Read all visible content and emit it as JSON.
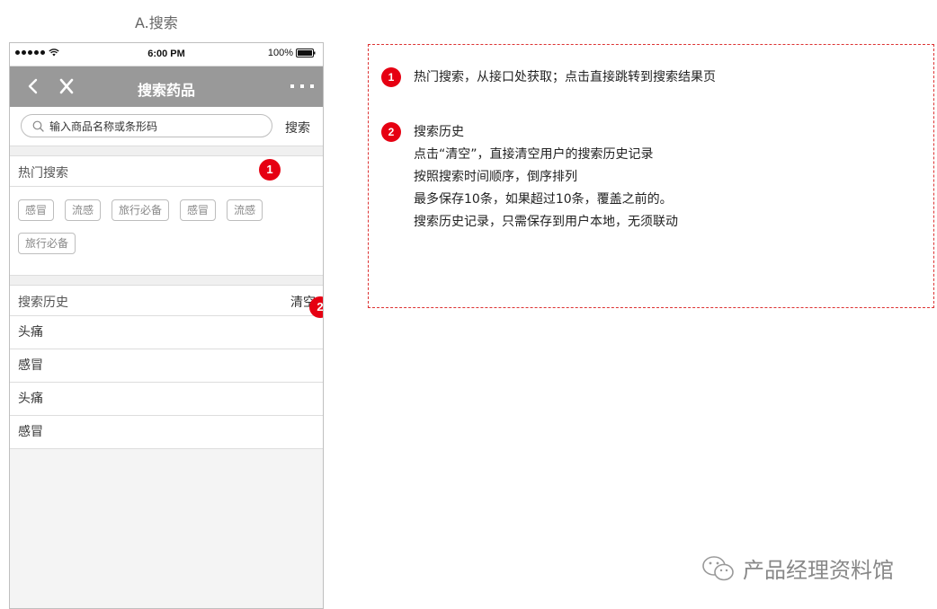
{
  "page": {
    "title": "A.搜索"
  },
  "status_bar": {
    "time": "6:00 PM",
    "battery": "100%"
  },
  "nav": {
    "title": "搜索药品",
    "close_label": "X"
  },
  "search": {
    "placeholder": "输入商品名称或条形码",
    "button_label": "搜索"
  },
  "hot_search": {
    "label": "热门搜索",
    "badge": "1",
    "tags": [
      "感冒",
      "流感",
      "旅行必备",
      "感冒",
      "流感",
      "旅行必备"
    ]
  },
  "history": {
    "label": "搜索历史",
    "clear_label": "清空",
    "badge": "2",
    "items": [
      "头痛",
      "感冒",
      "头痛",
      "感冒"
    ]
  },
  "notes": [
    {
      "badge": "1",
      "lines": [
        "热门搜索，从接口处获取；点击直接跳转到搜索结果页"
      ]
    },
    {
      "badge": "2",
      "lines": [
        "搜索历史",
        "点击“清空”，直接清空用户的搜索历史记录",
        "按照搜索时间顺序，倒序排列",
        "最多保存10条，如果超过10条，覆盖之前的。",
        "搜索历史记录，只需保存到用户本地，无须联动"
      ]
    }
  ],
  "watermark": {
    "text": "产品经理资料馆"
  },
  "colors": {
    "nav": "#999999",
    "badge": "#e60012",
    "dashed_border": "#dd3333"
  }
}
